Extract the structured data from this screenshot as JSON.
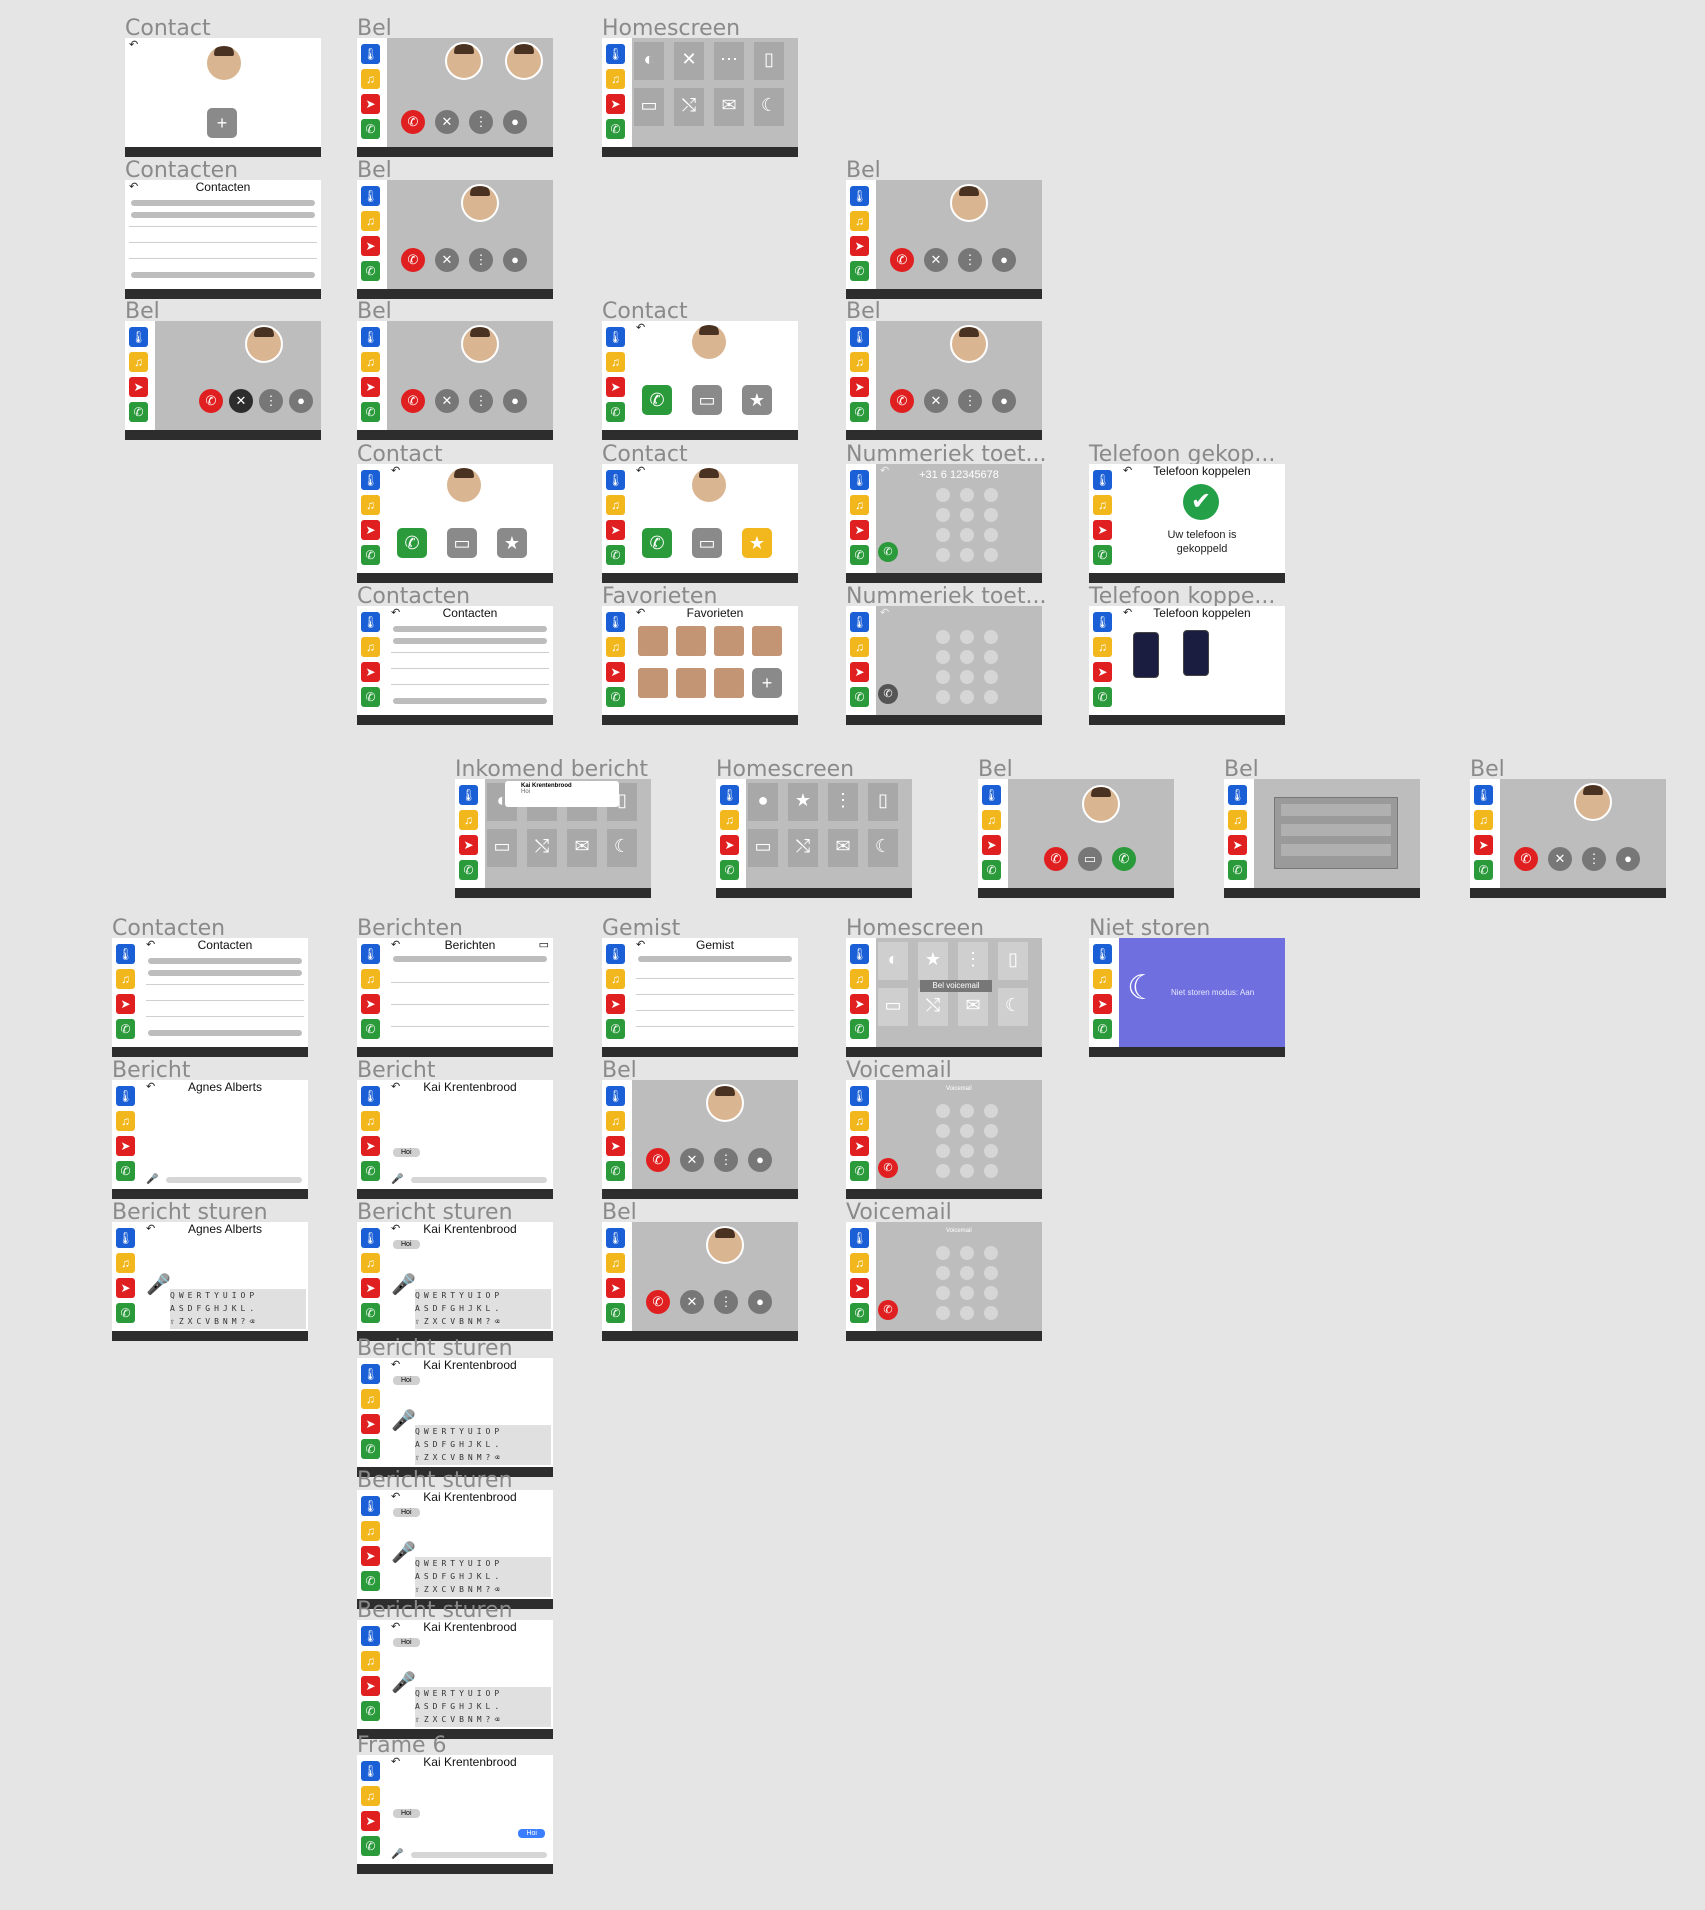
{
  "frames": {
    "contact_1": "Contact",
    "bel_1": "Bel",
    "homescreen_1": "Homescreen",
    "contacten_1": "Contacten",
    "bel_2": "Bel",
    "bel_3": "Bel",
    "bel_4": "Bel",
    "bel_5": "Bel",
    "contact_2": "Contact",
    "bel_6": "Bel",
    "contact_3": "Contact",
    "contact_4": "Contact",
    "nummeriek_1": "Nummeriek toet...",
    "telefoon_gekop": "Telefoon gekop...",
    "contacten_2": "Contacten",
    "favorieten": "Favorieten",
    "nummeriek_2": "Nummeriek toet...",
    "telefoon_koppe": "Telefoon koppe...",
    "inkomend": "Inkomend bericht",
    "homescreen_2": "Homescreen",
    "bel_7": "Bel",
    "bel_8": "Bel",
    "bel_9": "Bel",
    "contacten_3": "Contacten",
    "berichten": "Berichten",
    "gemist": "Gemist",
    "homescreen_3": "Homescreen",
    "niet_storen": "Niet storen",
    "bericht_1": "Bericht",
    "bericht_2": "Bericht",
    "bel_10": "Bel",
    "voicemail_1": "Voicemail",
    "bericht_sturen_1": "Bericht sturen",
    "bericht_sturen_2": "Bericht sturen",
    "bel_11": "Bel",
    "voicemail_2": "Voicemail",
    "bericht_sturen_3": "Bericht sturen",
    "bericht_sturen_4": "Bericht sturen",
    "bericht_sturen_5": "Bericht sturen",
    "frame_6": "Frame 6"
  },
  "headers": {
    "contacten": "Contacten",
    "favorieten": "Favorieten",
    "telefoon_koppelen": "Telefoon koppelen",
    "berichten": "Berichten",
    "gemist": "Gemist",
    "agnes": "Agnes Alberts",
    "kai": "Kai Krentenbrood"
  },
  "texts": {
    "gekoppeld_line1": "Uw telefoon is",
    "gekoppeld_line2": "gekoppeld",
    "phone_number": "+31 6 12345678",
    "bel_voicemail": "Bel voicemail",
    "niet_storen_modus": "Niet storen modus: Aan",
    "hoi": "Hoi",
    "inkomend_name": "Kai Krentenbrood",
    "inkomend_msg": "Hoi",
    "voicemail": "Voicemail"
  },
  "keyboard": {
    "row1": "QWERTYUIOP",
    "row2": "ASDFGHJKL.",
    "row3": "⇧ZXCVBNM?⌫"
  },
  "icons": {
    "side_blue": "thermometer-icon",
    "side_yellow": "music-note-icon",
    "side_red": "location-arrow-icon",
    "side_green": "phone-icon"
  },
  "colors": {
    "canvas": "#e5e5e5",
    "side_blue": "#1a5fd6",
    "side_yellow": "#f2b71d",
    "side_red": "#e02020",
    "side_green": "#2a9a3a",
    "niet_storen_bg": "#6f6fe0"
  }
}
